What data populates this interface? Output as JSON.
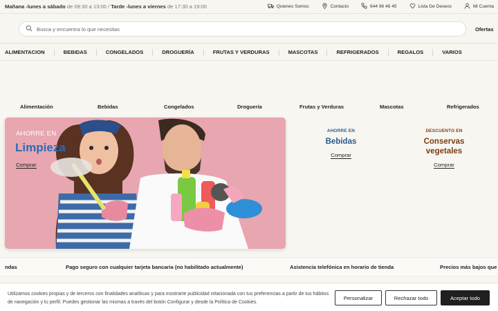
{
  "topbar": {
    "hours_part1_label": "Mañana -lunes a sábado",
    "hours_part1_time": " de 09:30 a 13:00 / ",
    "hours_part2_label": "Tarde -lunes a viernes",
    "hours_part2_time": " de 17:30 a 19:00",
    "links": {
      "about": "Quienes Somos",
      "contact": "Contacto",
      "phone": "644 96 46 45",
      "wishlist": "Lista De Deseos",
      "account": "Mi Cuenta"
    }
  },
  "search": {
    "placeholder": "Busca y encuentra lo que necesitas"
  },
  "ofertas": "Ofertas",
  "catnav": {
    "items": [
      "ALIMENTACION",
      "BEBIDAS",
      "CONGELADOS",
      "DROGUERÍA",
      "FRUTAS Y VERDURAS",
      "MASCOTAS",
      "REFRIGERADOS",
      "REGALOS",
      "VARIOS"
    ]
  },
  "cattabs": {
    "items": [
      "Alimentación",
      "Bebidas",
      "Congelados",
      "Droguería",
      "Frutas y Verduras",
      "Mascotas",
      "Refrigerados"
    ]
  },
  "hero": {
    "kicker": "AHORRE EN",
    "title": "Limpieza",
    "cta": "Comprar"
  },
  "promo_bebidas": {
    "kicker": "AHORRE EN",
    "title": "Bebidas",
    "cta": "Comprar"
  },
  "promo_conservas": {
    "kicker": "DESCUENTO EN",
    "title_line1": "Conservas",
    "title_line2": "vegetales",
    "cta": "Comprar"
  },
  "marquee": {
    "items": [
      "ndas",
      "Pago seguro con cualquier tarjeta bancaria (no habilitado actualmente)",
      "Asistencia telefónica en horario de tienda",
      "Precios más bajos que"
    ]
  },
  "cookie": {
    "text": "Utilizamos cookies propias y de terceros con finalidades analíticas y para mostrarte publicidad relacionada con tus preferencias a partir de tus hábitos de navegación y tu perfil. Puedes gestionar las mismas a través del botón Configurar y desde la Política de Cookies.",
    "personalizar": "Personalizar",
    "reject": "Rechazar todo",
    "accept": "Aceptar todo"
  },
  "colors": {
    "background": "#f8f6f1",
    "hero_bg": "#e7a6b0",
    "hero_title": "#2a6bb5",
    "bebidas_accent": "#2a5a8a",
    "conservas_accent": "#7a3d14",
    "accept_button": "#1f1f1f"
  },
  "icons": [
    "truck-icon",
    "location-pin-icon",
    "phone-icon",
    "heart-icon",
    "user-icon",
    "search-icon"
  ]
}
